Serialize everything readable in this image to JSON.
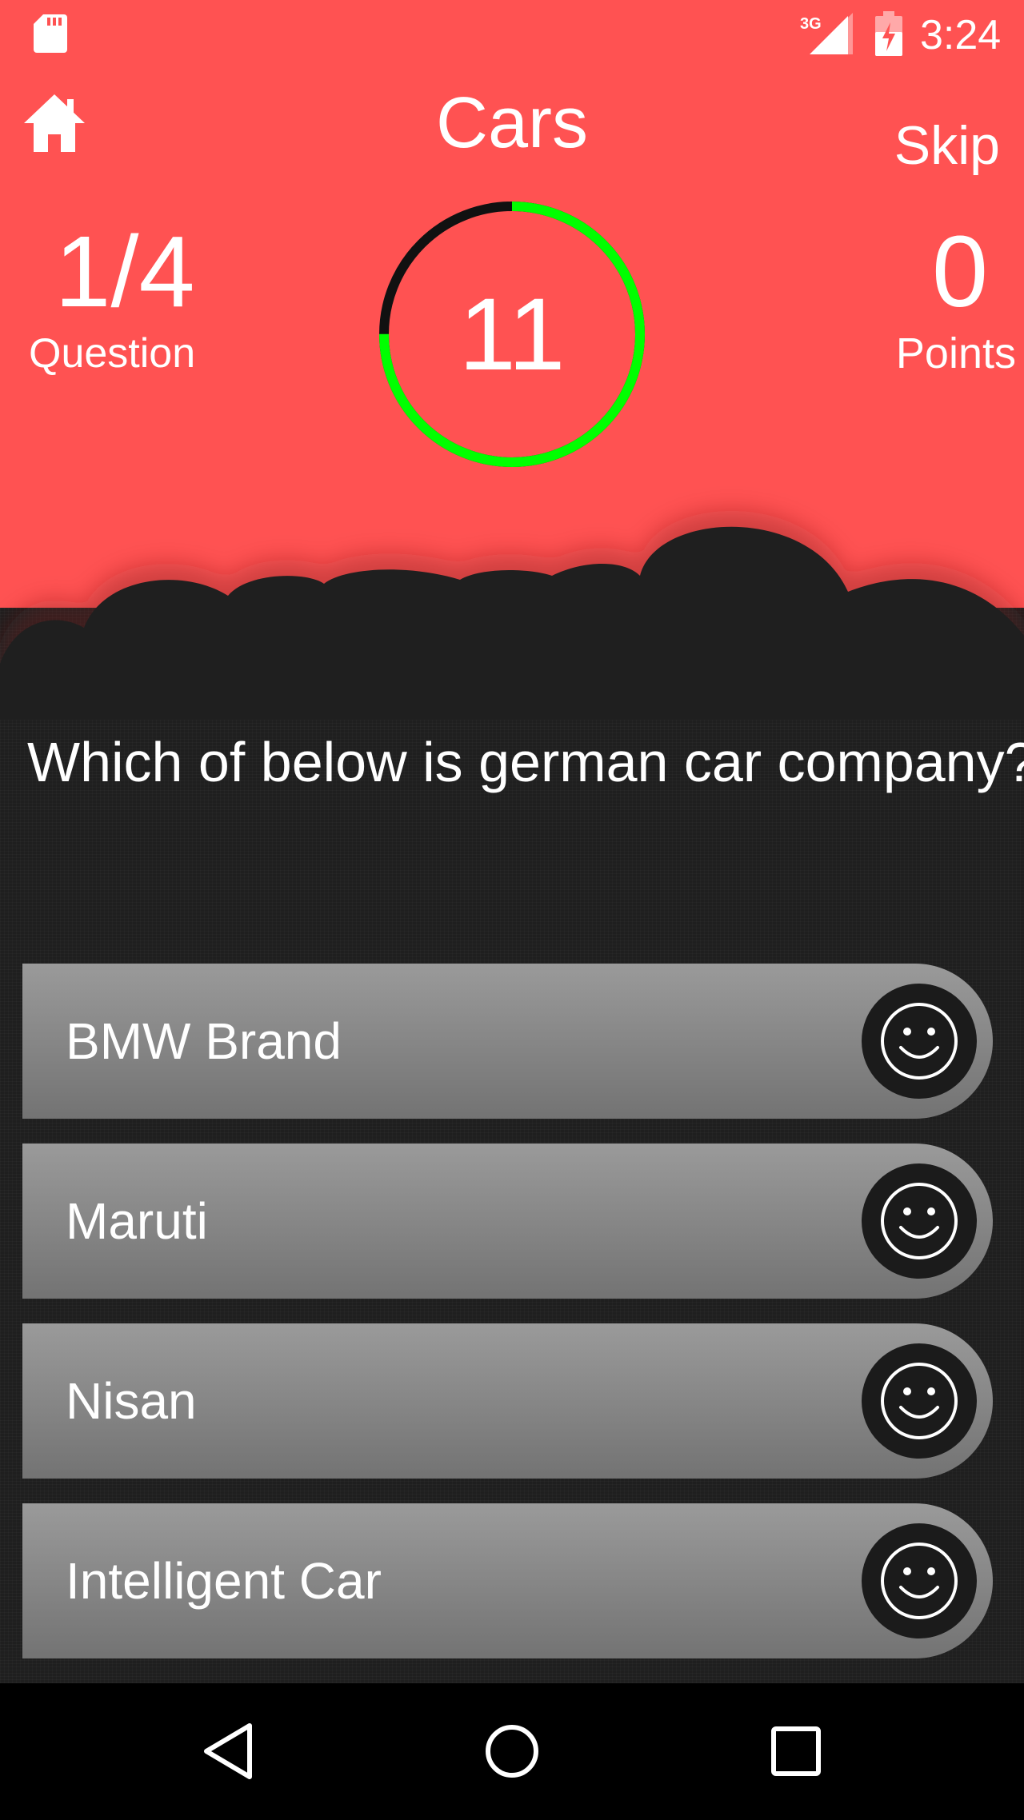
{
  "status_bar": {
    "time": "3:24",
    "network": "3G",
    "icons": [
      "sd-card-icon",
      "signal-icon",
      "battery-charging-icon"
    ]
  },
  "header": {
    "title": "Cars",
    "skip_label": "Skip",
    "home_icon": "home-icon"
  },
  "stats": {
    "question_value": "1/4",
    "question_label": "Question",
    "points_value": "0",
    "points_label": "Points"
  },
  "timer": {
    "value": "11",
    "progress_fraction": 0.75,
    "colors": {
      "progress": "#00ff00",
      "track": "#111111"
    }
  },
  "question": {
    "text": "Which of below is german car company?"
  },
  "answers": [
    {
      "label": "BMW Brand",
      "icon": "smiley-icon"
    },
    {
      "label": "Maruti",
      "icon": "smiley-icon"
    },
    {
      "label": "Nisan",
      "icon": "smiley-icon"
    },
    {
      "label": "Intelligent Car",
      "icon": "smiley-icon"
    }
  ],
  "nav_bar": {
    "buttons": [
      "back-icon",
      "home-circle-icon",
      "recents-icon"
    ]
  },
  "colors": {
    "header_bg": "#ff5252",
    "body_bg": "#1f1f1f",
    "answer_top": "#9a9a9a",
    "answer_bottom": "#737373"
  }
}
